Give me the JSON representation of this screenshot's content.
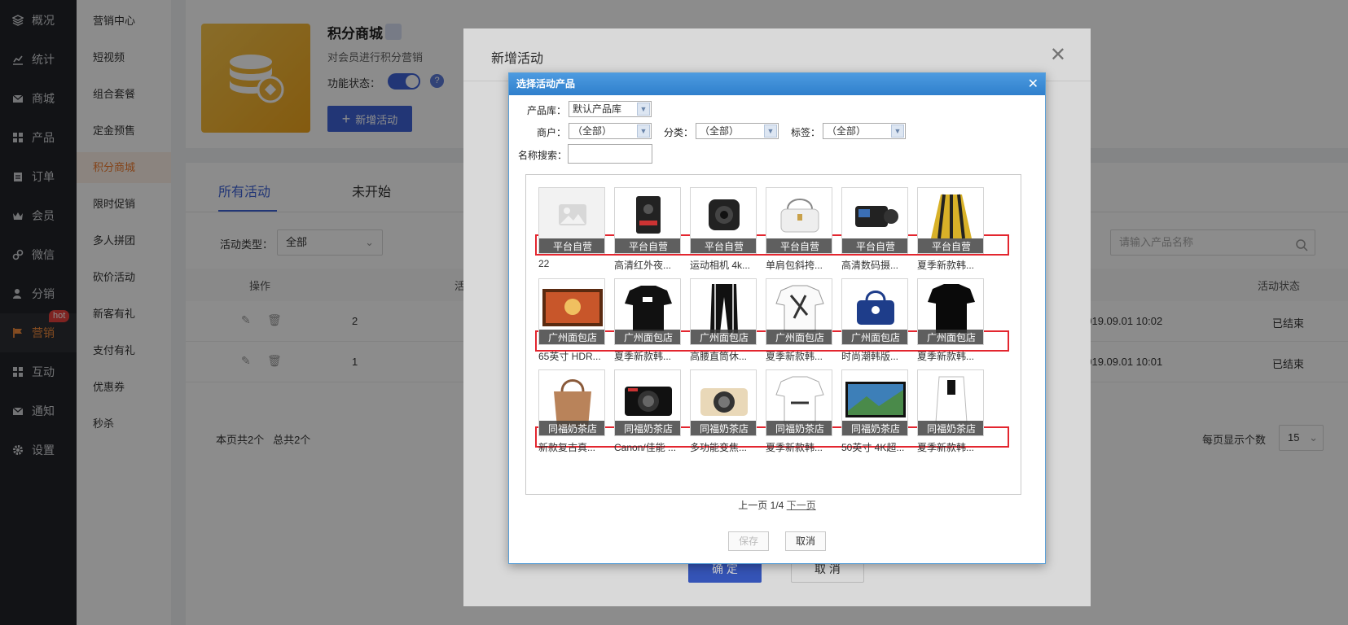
{
  "sidebar": {
    "items": [
      {
        "label": "概况",
        "icon": "layers-icon"
      },
      {
        "label": "统计",
        "icon": "chart-icon"
      },
      {
        "label": "商城",
        "icon": "mail-icon"
      },
      {
        "label": "产品",
        "icon": "grid-icon"
      },
      {
        "label": "订单",
        "icon": "clipboard-icon"
      },
      {
        "label": "会员",
        "icon": "crown-icon"
      },
      {
        "label": "微信",
        "icon": "link-icon"
      },
      {
        "label": "分销",
        "icon": "user-icon"
      },
      {
        "label": "营销",
        "icon": "flag-icon"
      },
      {
        "label": "互动",
        "icon": "grid-icon"
      },
      {
        "label": "通知",
        "icon": "mail-icon"
      },
      {
        "label": "设置",
        "icon": "gear-icon"
      }
    ],
    "hot_badge": "hot"
  },
  "submenu": {
    "items": [
      "营销中心",
      "短视频",
      "组合套餐",
      "定金预售",
      "积分商城",
      "限时促销",
      "多人拼团",
      "砍价活动",
      "新客有礼",
      "支付有礼",
      "优惠券",
      "秒杀"
    ]
  },
  "hero": {
    "title": "积分商城",
    "subtitle": "对会员进行积分营销",
    "state_label": "功能状态：",
    "help": "?",
    "add_button": "新增活动"
  },
  "tabs": [
    "所有活动",
    "未开始"
  ],
  "filter": {
    "type_label": "活动类型：",
    "type_value": "全部",
    "search_placeholder": "请输入产品名称"
  },
  "table": {
    "headers": {
      "op": "操作",
      "name": "活",
      "status": "活动状态"
    },
    "rows": [
      {
        "id": "2",
        "time": "2019.09.01 10:02",
        "status": "已结束"
      },
      {
        "id": "1",
        "time": "2019.09.01 10:01",
        "status": "已结束"
      }
    ],
    "summary": "本页共2个   总共2个",
    "page_size_label": "每页显示个数",
    "page_size": "15"
  },
  "dialog": {
    "title": "新增活动",
    "ok": "确 定",
    "cancel": "取 消"
  },
  "picker": {
    "title": "选择活动产品",
    "library_label": "产品库：",
    "library_value": "默认产品库",
    "merchant_label": "商户：",
    "merchant_value": "（全部）",
    "category_label": "分类：",
    "category_value": "（全部）",
    "tag_label": "标签：",
    "tag_value": "（全部）",
    "search_label": "名称搜索：",
    "search_value": "",
    "pager_prev": "上一页",
    "pager_pos": "1/4",
    "pager_next": "下一页",
    "save": "保存",
    "cancel": "取消",
    "rows": [
      [
        {
          "shop": "平台自营",
          "name": "22",
          "img": "placeholder"
        },
        {
          "shop": "平台自营",
          "name": "高清红外夜...",
          "img": "camera-body"
        },
        {
          "shop": "平台自营",
          "name": "运动相机 4k...",
          "img": "action-cam"
        },
        {
          "shop": "平台自营",
          "name": "单肩包斜挎...",
          "img": "bag"
        },
        {
          "shop": "平台自营",
          "name": "高清数码摄...",
          "img": "camcorder"
        },
        {
          "shop": "平台自营",
          "name": "夏季新款韩...",
          "img": "skirt"
        }
      ],
      [
        {
          "shop": "广州面包店",
          "name": "65英寸 HDR...",
          "img": "tv"
        },
        {
          "shop": "广州面包店",
          "name": "夏季新款韩...",
          "img": "tshirt"
        },
        {
          "shop": "广州面包店",
          "name": "高腰直筒休...",
          "img": "pants"
        },
        {
          "shop": "广州面包店",
          "name": "夏季新款韩...",
          "img": "print-shirt"
        },
        {
          "shop": "广州面包店",
          "name": "时尚潮韩版...",
          "img": "handbag"
        },
        {
          "shop": "广州面包店",
          "name": "夏季新款韩...",
          "img": "black-tee"
        }
      ],
      [
        {
          "shop": "同福奶茶店",
          "name": "新款复古真...",
          "img": "tote"
        },
        {
          "shop": "同福奶茶店",
          "name": "Canon/佳能 ...",
          "img": "compact-cam"
        },
        {
          "shop": "同福奶茶店",
          "name": "多功能变焦...",
          "img": "gold-cam"
        },
        {
          "shop": "同福奶茶店",
          "name": "夏季新款韩...",
          "img": "white-shirt"
        },
        {
          "shop": "同福奶茶店",
          "name": "50英寸 4K超...",
          "img": "tv2"
        },
        {
          "shop": "同福奶茶店",
          "name": "夏季新款韩...",
          "img": "white-top"
        }
      ]
    ]
  }
}
